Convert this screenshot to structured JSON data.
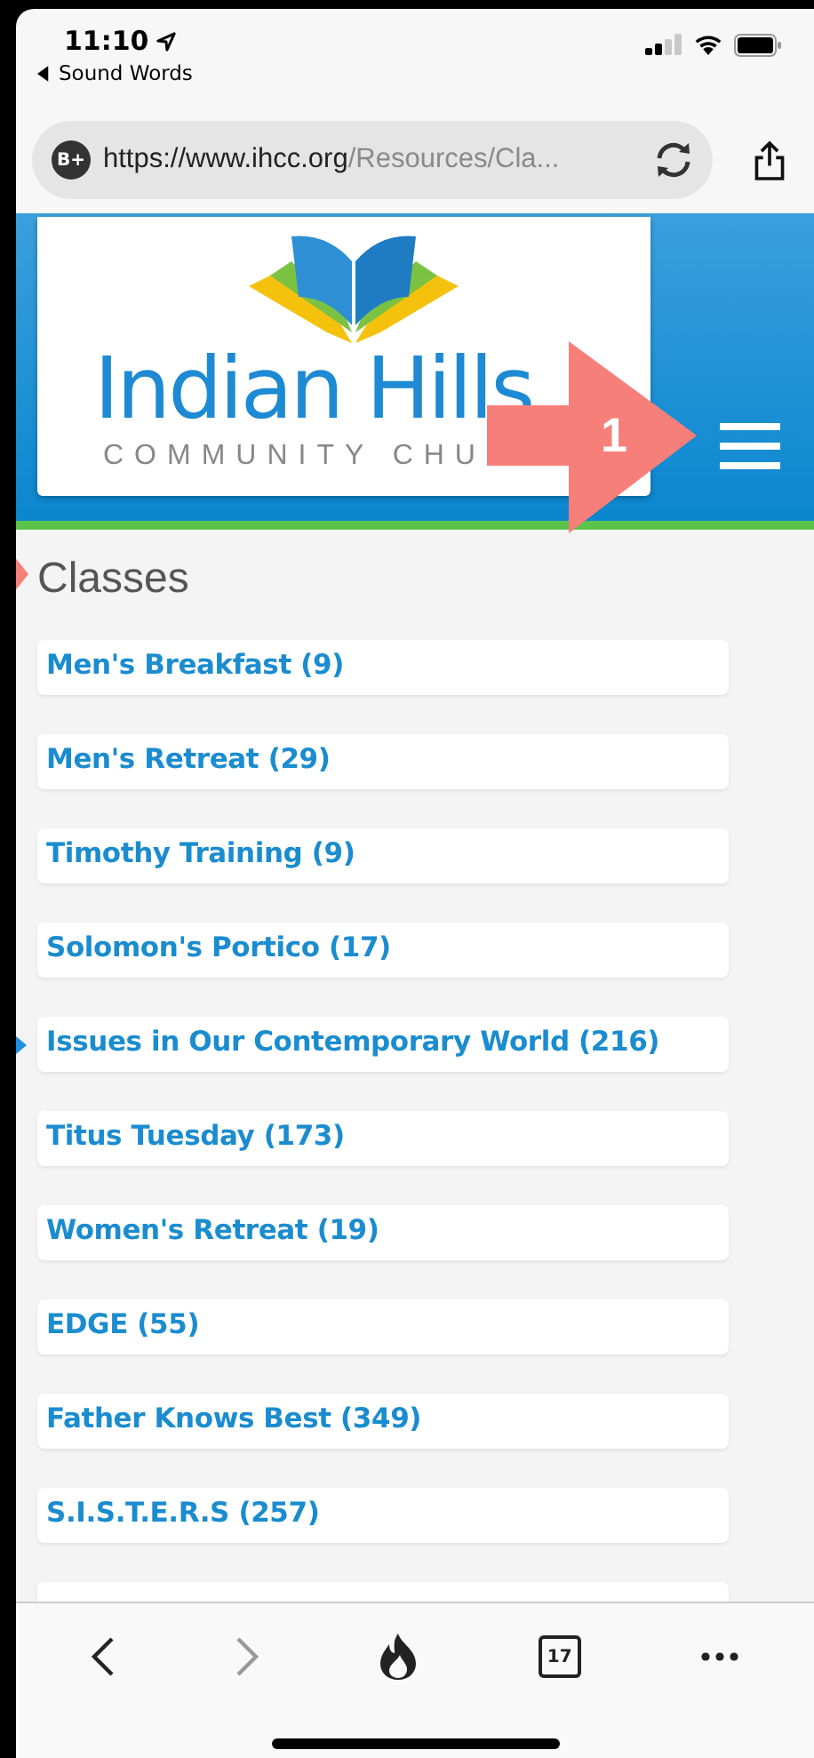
{
  "status_bar": {
    "time": "11:10",
    "back_label": "Sound Words"
  },
  "address_bar": {
    "badge": "B+",
    "url_host": "https://www.ihcc.org",
    "url_path": "/Resources/Cla..."
  },
  "header": {
    "logo_title": "Indian Hills",
    "logo_subtitle": "COMMUNITY CHU"
  },
  "annotation": {
    "number": "1"
  },
  "page": {
    "title": "Classes",
    "classes": [
      {
        "label": "Men's Breakfast (9)"
      },
      {
        "label": "Men's Retreat (29)"
      },
      {
        "label": "Timothy Training (9)"
      },
      {
        "label": "Solomon's Portico (17)"
      },
      {
        "label": "Issues in Our Contemporary World (216)"
      },
      {
        "label": "Titus Tuesday (173)"
      },
      {
        "label": "Women's Retreat (19)"
      },
      {
        "label": "EDGE (55)"
      },
      {
        "label": "Father Knows Best (349)"
      },
      {
        "label": "S.I.S.T.E.R.S (257)"
      },
      {
        "kind": "cut-off"
      }
    ]
  },
  "toolbar": {
    "tab_count": "17"
  }
}
